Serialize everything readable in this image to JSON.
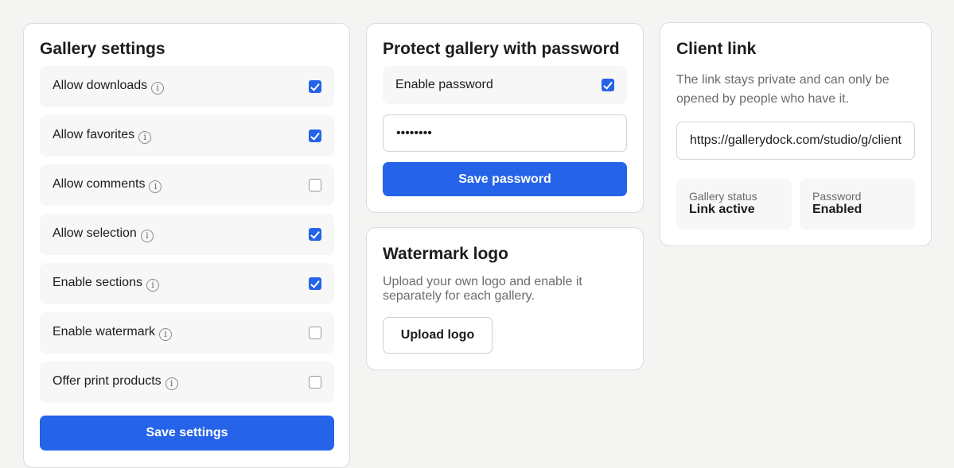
{
  "gallery_settings": {
    "title": "Gallery settings",
    "options": [
      {
        "label": "Allow downloads",
        "checked": true
      },
      {
        "label": "Allow favorites",
        "checked": true
      },
      {
        "label": "Allow comments",
        "checked": false
      },
      {
        "label": "Allow selection",
        "checked": true
      },
      {
        "label": "Enable sections",
        "checked": true
      },
      {
        "label": "Enable watermark",
        "checked": false
      },
      {
        "label": "Offer print products",
        "checked": false
      }
    ],
    "info_glyph": "ⓘ",
    "save_label": "Save settings"
  },
  "password": {
    "title": "Protect gallery with password",
    "enable_label": "Enable password",
    "enabled": true,
    "value": "password",
    "save_label": "Save password"
  },
  "watermark": {
    "title": "Watermark logo",
    "description": "Upload your own logo and enable it separately for each gallery.",
    "upload_label": "Upload logo"
  },
  "client_link": {
    "title": "Client link",
    "description": "The link stays private and can only be opened by people who have it.",
    "url": "https://gallerydock.com/studio/g/client",
    "status_label": "Gallery status",
    "status_value": "Link active",
    "password_label": "Password",
    "password_value": "Enabled"
  },
  "colors": {
    "accent": "#2563e8",
    "background": "#f4f4f3",
    "card": "#ffffff",
    "row": "#f7f7f7"
  }
}
